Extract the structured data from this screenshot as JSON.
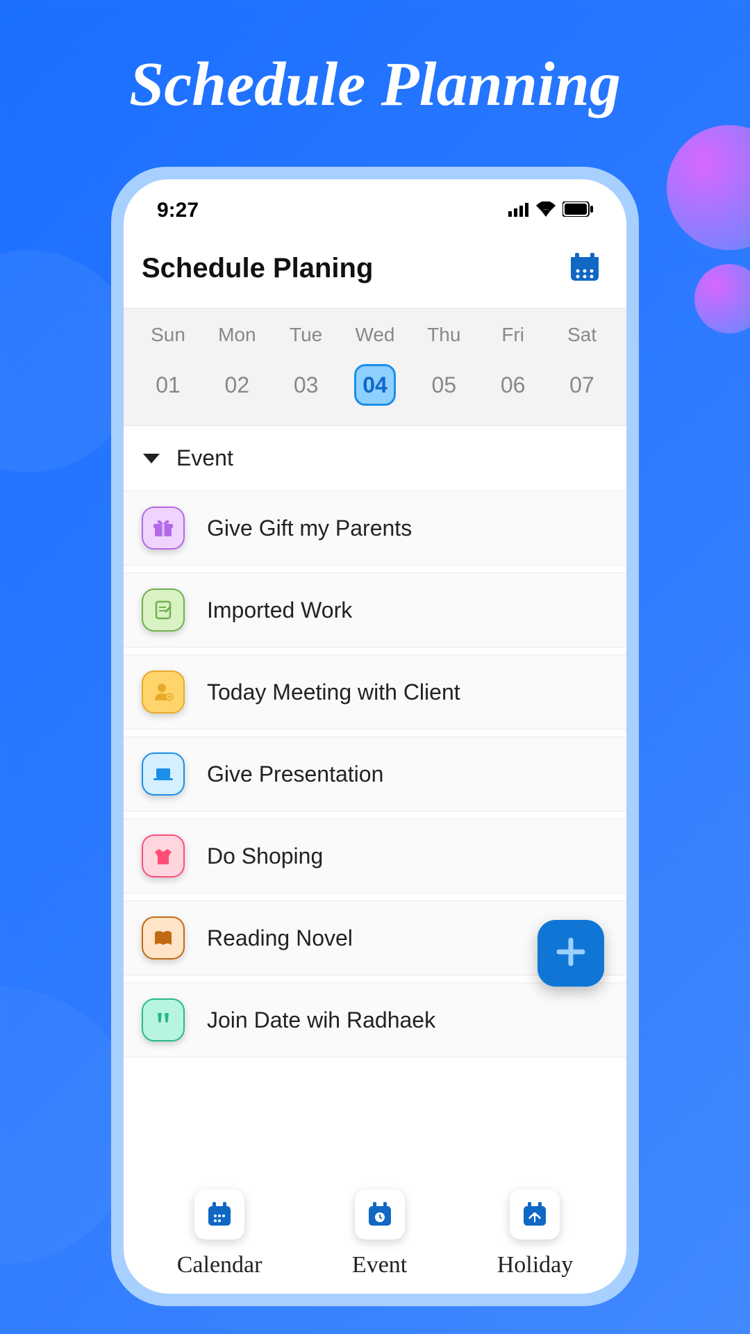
{
  "promo": {
    "title": "Schedule Planning"
  },
  "status_bar": {
    "time": "9:27"
  },
  "header": {
    "title": "Schedule Planing"
  },
  "week": {
    "days": [
      {
        "label": "Sun",
        "num": "01",
        "selected": false
      },
      {
        "label": "Mon",
        "num": "02",
        "selected": false
      },
      {
        "label": "Tue",
        "num": "03",
        "selected": false
      },
      {
        "label": "Wed",
        "num": "04",
        "selected": true
      },
      {
        "label": "Thu",
        "num": "05",
        "selected": false
      },
      {
        "label": "Fri",
        "num": "06",
        "selected": false
      },
      {
        "label": "Sat",
        "num": "07",
        "selected": false
      }
    ]
  },
  "section": {
    "title": "Event"
  },
  "events": [
    {
      "label": "Give Gift my Parents",
      "icon": "gift-icon",
      "bg": "#f0d4ff",
      "border": "#b368e8",
      "color": "#b368e8"
    },
    {
      "label": "Imported Work",
      "icon": "note-icon",
      "bg": "#d9f2c4",
      "border": "#6fb04c",
      "color": "#6fb04c"
    },
    {
      "label": "Today Meeting with Client",
      "icon": "person-add-icon",
      "bg": "#ffd46b",
      "border": "#e8aa28",
      "color": "#e8aa28"
    },
    {
      "label": "Give Presentation",
      "icon": "laptop-icon",
      "bg": "#d4efff",
      "border": "#1a8fe8",
      "color": "#1a8fe8"
    },
    {
      "label": "Do Shoping",
      "icon": "shirt-icon",
      "bg": "#ffd6de",
      "border": "#ff4d78",
      "color": "#ff4d78"
    },
    {
      "label": "Reading Novel",
      "icon": "book-icon",
      "bg": "#ffe4c8",
      "border": "#c26a12",
      "color": "#c26a12"
    },
    {
      "label": "Join Date wih Radhaek",
      "icon": "cheers-icon",
      "bg": "#b8f5e0",
      "border": "#28b986",
      "color": "#28b986"
    }
  ],
  "bottom_nav": {
    "items": [
      {
        "label": "Calendar",
        "icon": "calendar-icon"
      },
      {
        "label": "Event",
        "icon": "event-icon"
      },
      {
        "label": "Holiday",
        "icon": "holiday-icon"
      }
    ]
  },
  "colors": {
    "accent": "#1068c4"
  }
}
